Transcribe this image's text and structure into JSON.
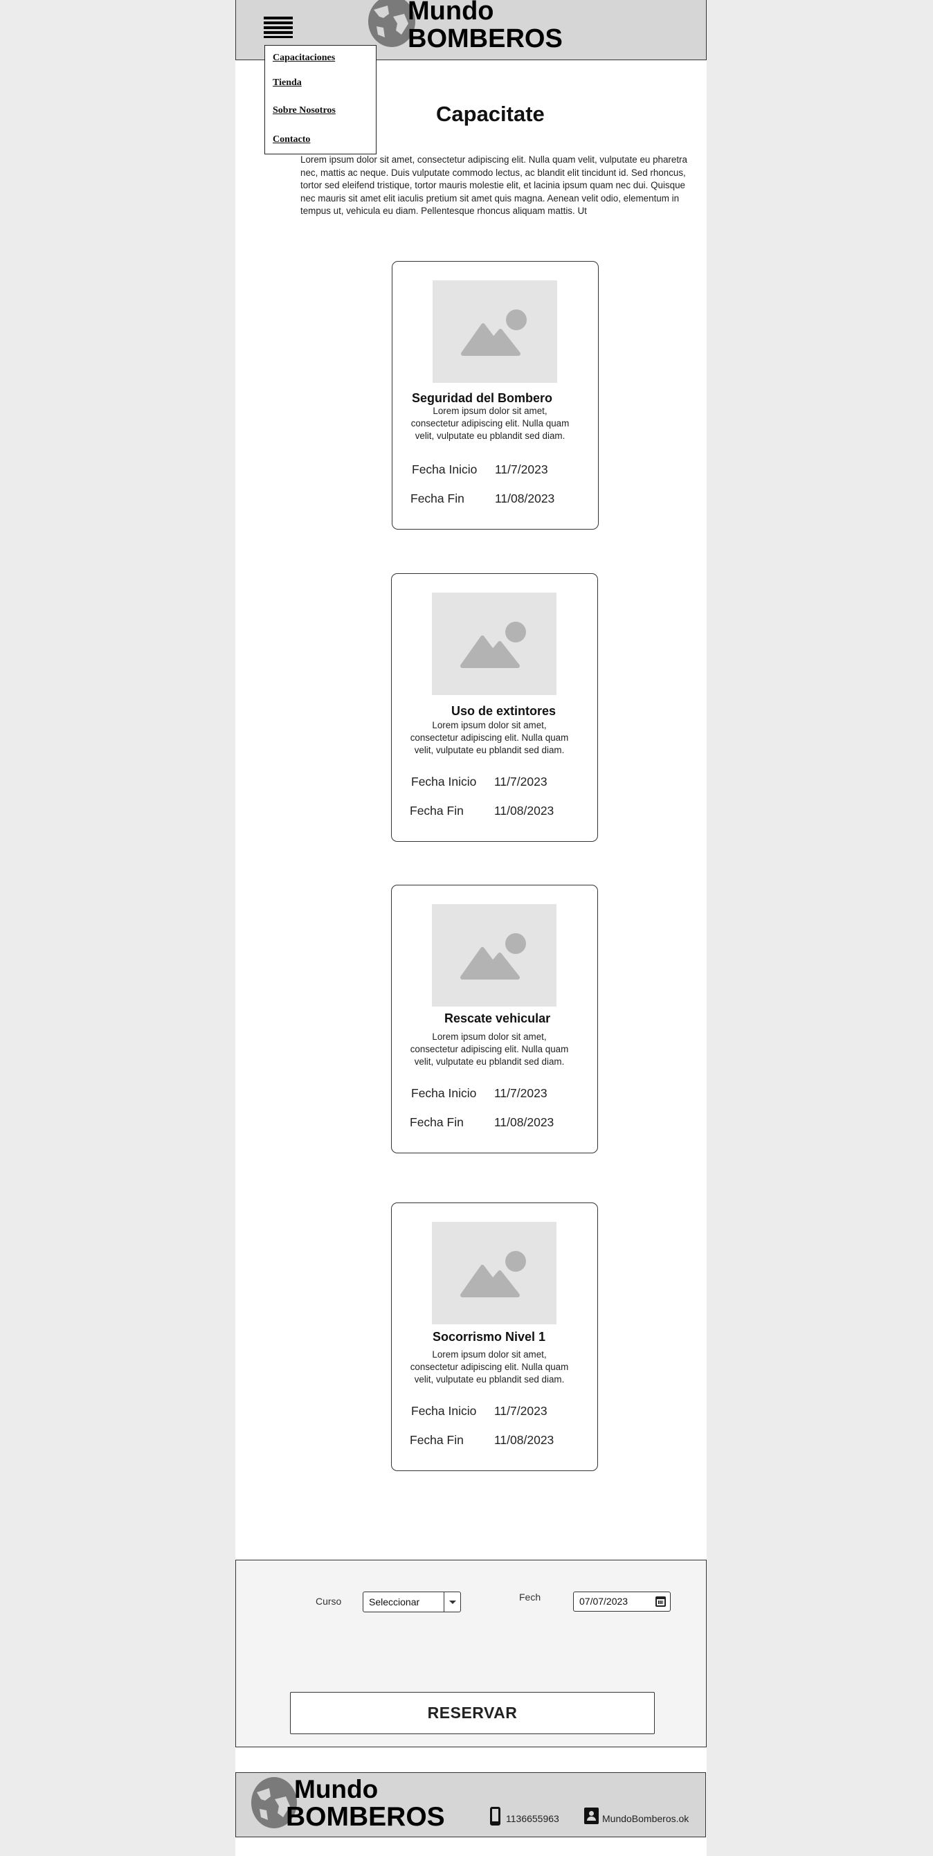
{
  "header": {
    "brand_line1": "Mundo",
    "brand_line2": "BOMBEROS",
    "menu_icon": "hamburger-menu-icon",
    "logo_icon": "globe-logo-icon"
  },
  "nav_menu": {
    "items": [
      "Capacitaciones",
      "Tienda",
      "Sobre Nosotros",
      "Contacto"
    ]
  },
  "intro": {
    "title": "Capacitate",
    "text": "Lorem ipsum dolor sit amet, consectetur adipiscing elit. Nulla quam velit, vulputate eu pharetra nec, mattis ac neque. Duis vulputate commodo lectus, ac blandit elit tincidunt id. Sed rhoncus, tortor sed eleifend tristique, tortor mauris molestie elit, et lacinia ipsum quam nec dui. Quisque nec mauris sit amet elit iaculis pretium sit amet quis magna. Aenean velit odio, elementum in tempus ut, vehicula eu diam. Pellentesque rhoncus aliquam mattis. Ut"
  },
  "courses": [
    {
      "title": "Seguridad del Bombero",
      "description": "Lorem ipsum dolor sit amet, consectetur adipiscing elit. Nulla quam velit, vulputate eu pblandit sed diam.",
      "start_label": "Fecha Inicio",
      "start_date": "11/7/2023",
      "end_label": "Fecha Fin",
      "end_date": "11/08/2023",
      "image_icon": "image-placeholder-icon"
    },
    {
      "title": "Uso de extintores",
      "description": "Lorem ipsum dolor sit amet, consectetur adipiscing elit. Nulla quam velit, vulputate eu pblandit sed diam.",
      "start_label": "Fecha Inicio",
      "start_date": "11/7/2023",
      "end_label": "Fecha Fin",
      "end_date": "11/08/2023",
      "image_icon": "image-placeholder-icon"
    },
    {
      "title": "Rescate vehicular",
      "description": "Lorem ipsum dolor sit amet, consectetur adipiscing elit. Nulla quam velit, vulputate eu pblandit sed diam.",
      "start_label": "Fecha Inicio",
      "start_date": "11/7/2023",
      "end_label": "Fecha Fin",
      "end_date": "11/08/2023",
      "image_icon": "image-placeholder-icon"
    },
    {
      "title": "Socorrismo Nivel 1",
      "description": "Lorem ipsum dolor sit amet, consectetur adipiscing elit. Nulla quam velit, vulputate eu pblandit sed diam.",
      "start_label": "Fecha Inicio",
      "start_date": "11/7/2023",
      "end_label": "Fecha Fin",
      "end_date": "11/08/2023",
      "image_icon": "image-placeholder-icon"
    }
  ],
  "booking": {
    "course_label": "Curso",
    "course_value": "Seleccionar",
    "date_label": "Fech",
    "date_value": "07/07/2023",
    "submit_label": "RESERVAR",
    "calendar_icon": "calendar-icon"
  },
  "footer": {
    "brand_line1": "Mundo",
    "brand_line2": "BOMBEROS",
    "phone": "1136655963",
    "contact": "MundoBomberos.ok",
    "phone_icon": "phone-icon",
    "contact_icon": "contact-badge-icon"
  },
  "colors": {
    "page_bg": "#ececec",
    "header_bg": "#d6d6d6",
    "placeholder_bg": "#e4e4e4",
    "placeholder_fg": "#b3b3b3",
    "logo_gray": "#7a7a7a"
  }
}
